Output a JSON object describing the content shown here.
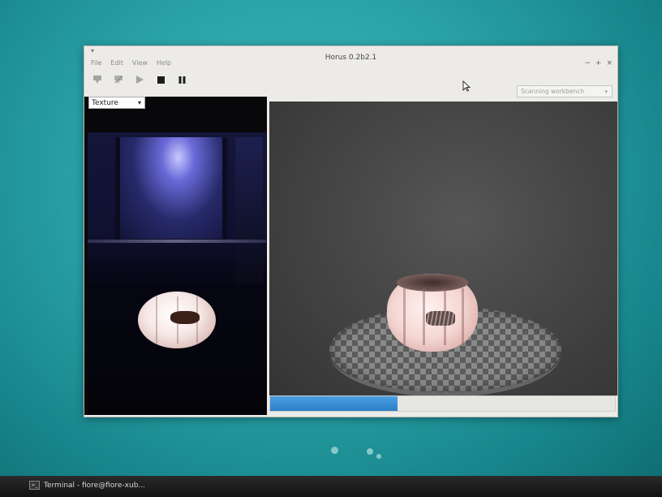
{
  "window": {
    "title": "Horus 0.2b2.1",
    "menu_arrow": "▾",
    "controls": {
      "minimize": "−",
      "maximize": "+",
      "close": "×"
    }
  },
  "menubar": {
    "items": [
      "File",
      "Edit",
      "View",
      "Help"
    ]
  },
  "toolbar": {
    "buttons": [
      "connect-icon",
      "disconnect-icon",
      "play-icon",
      "stop-icon",
      "pause-icon"
    ]
  },
  "workbench_select": {
    "value": "Scanning workbench",
    "arrow": "▾"
  },
  "camera_view": {
    "mode": "Texture",
    "arrow": "▾"
  },
  "scan_progress": {
    "fraction": 0.37
  },
  "taskbar": {
    "item_label": "Terminal - fiore@fiore-xub...",
    "terminal_glyph": ">_"
  },
  "colors": {
    "desktop": "#2aa3a8",
    "window_bg": "#ecebe8",
    "progress_fill": "#2c7ec8",
    "scene_bg": "#464646"
  }
}
